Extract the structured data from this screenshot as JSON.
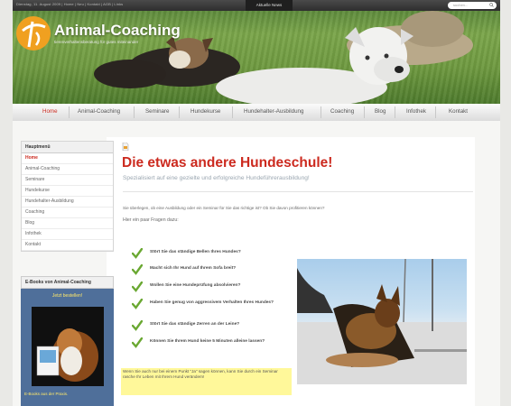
{
  "topbar": {
    "date_and_links": "Dienstag, 11. August 2009 | Home | Neu | Kontakt | AGB | Links",
    "center_tab": "Aktuelle News",
    "search_placeholder": "suchen..."
  },
  "brand": {
    "name": "Animal-Coaching",
    "tagline": "tierenverhaltensberatung für gutes miteinander"
  },
  "nav": {
    "items": [
      {
        "label": "Home",
        "active": true
      },
      {
        "label": "Animal-Coaching",
        "active": false
      },
      {
        "label": "Seminare",
        "active": false
      },
      {
        "label": "Hundekurse",
        "active": false
      },
      {
        "label": "Hundehalter-Ausbildung",
        "active": false
      },
      {
        "label": "Coaching",
        "active": false
      },
      {
        "label": "Blog",
        "active": false
      },
      {
        "label": "Infothek",
        "active": false
      },
      {
        "label": "Kontakt",
        "active": false
      }
    ]
  },
  "sidebar": {
    "heading": "Hauptmenü",
    "items": [
      {
        "label": "Home",
        "active": true
      },
      {
        "label": "Animal-Coaching",
        "active": false
      },
      {
        "label": "Seminare",
        "active": false
      },
      {
        "label": "Hundekurse",
        "active": false
      },
      {
        "label": "Hundehalter-Ausbildung",
        "active": false
      },
      {
        "label": "Coaching",
        "active": false
      },
      {
        "label": "Blog",
        "active": false
      },
      {
        "label": "Infothek",
        "active": false
      },
      {
        "label": "Kontakt",
        "active": false
      }
    ]
  },
  "ebook": {
    "heading": "E-Books von Animal-Coaching",
    "new_label": "Jetzt bestellen!",
    "footer": "E-Books aus der Praxis."
  },
  "main": {
    "title": "Die etwas andere Hundeschule!",
    "subtitle": "Spezialisiert auf eine gezielte und erfolgreiche Hundeführerausbildung!",
    "intro_line": "Sie überlegen, ob eine Ausbildung oder ein Seminar für Sie das richtige ist? Ob Sie davon profitieren können?",
    "questions_intro": "Hier ein paar Fragen dazu:",
    "questions": [
      "Stört Sie das ständige Bellen Ihres Hundes?",
      "Macht sich Ihr Hund auf Ihrem Sofa breit?",
      "Wollen Sie eine Hundeprüfung absolvieren?",
      "Haben Sie genug von aggressivem Verhalten Ihres Hundes?",
      "Stört Sie das ständige Zerren an der Leine?",
      "Können Sie Ihrem Hund keine 5 Minuten alleine lassen?"
    ],
    "cta": "Wenn Sie auch nur bei einem Punkt \"Ja\" sagen können, kann Sie durch ein Seminar rasche Ihr Leben mit Ihrem Hund verändern!"
  },
  "colors": {
    "accent_red": "#cc2a1f",
    "highlight_yellow": "#fff89a",
    "check_green": "#6aa832"
  }
}
